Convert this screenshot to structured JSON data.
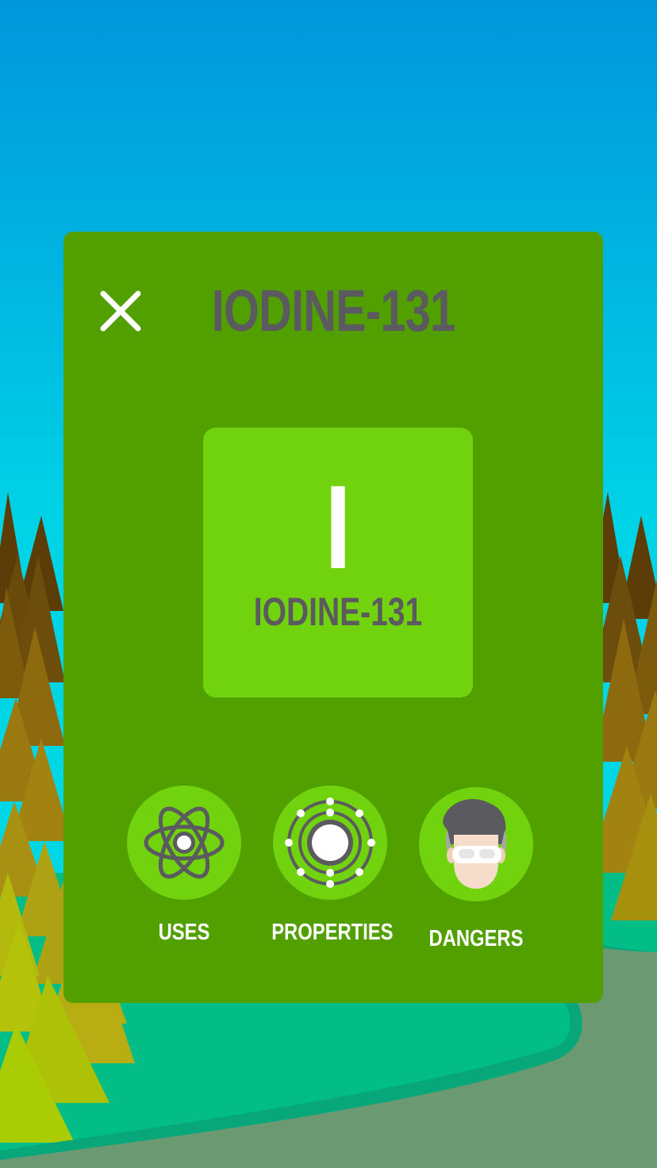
{
  "panel": {
    "title": "IODINE-131",
    "close_icon": "close-icon"
  },
  "element": {
    "symbol": "I",
    "name": "IODINE-131"
  },
  "actions": [
    {
      "label": "USES",
      "icon": "atom-icon"
    },
    {
      "label": "PROPERTIES",
      "icon": "electron-shell-icon"
    },
    {
      "label": "DANGERS",
      "icon": "scientist-goggles-icon"
    }
  ],
  "colors": {
    "panel": "#529f00",
    "tile": "#71d30e",
    "title_text": "#5a5a5f",
    "sky_top": "#0095dc",
    "sky_bottom": "#00d9e6",
    "river": "#02be86",
    "road": "#6b9a72"
  }
}
